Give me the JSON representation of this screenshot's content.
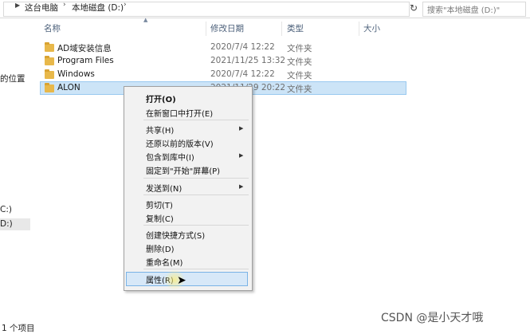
{
  "address": {
    "crumbs": [
      "这台电脑",
      "本地磁盘 (D:)"
    ],
    "search_placeholder": "搜索\"本地磁盘 (D:)\""
  },
  "nav": {
    "items": [
      "的位置",
      "C:)",
      "D:)"
    ]
  },
  "columns": {
    "name": "名称",
    "modified": "修改日期",
    "type": "类型",
    "size": "大小"
  },
  "files": [
    {
      "name": "AD域安装信息",
      "modified": "2020/7/4 12:22",
      "type": "文件夹"
    },
    {
      "name": "Program Files",
      "modified": "2021/11/25 13:32",
      "type": "文件夹"
    },
    {
      "name": "Windows",
      "modified": "2020/7/4 12:22",
      "type": "文件夹"
    },
    {
      "name": "ALON",
      "modified": "2021/11/29 20:22",
      "type": "文件夹"
    }
  ],
  "context_menu": {
    "open": "打开(O)",
    "open_new_window": "在新窗口中打开(E)",
    "share": "共享(H)",
    "restore_previous": "还原以前的版本(V)",
    "include_in_library": "包含到库中(I)",
    "pin_to_start": "固定到\"开始\"屏幕(P)",
    "send_to": "发送到(N)",
    "cut": "剪切(T)",
    "copy": "复制(C)",
    "create_shortcut": "创建快捷方式(S)",
    "delete": "删除(D)",
    "rename": "重命名(M)",
    "properties": "属性(R)"
  },
  "status": {
    "count": "1 个项目"
  },
  "watermark": "CSDN @是小天才哦",
  "colors": {
    "selection_bg": "#cce4f7",
    "selection_border": "#99c9ef",
    "folder": "#e8b84a",
    "header_text": "#4c607a"
  }
}
